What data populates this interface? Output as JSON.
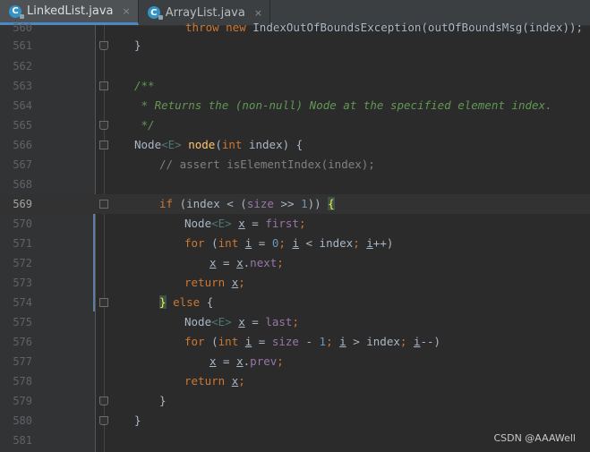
{
  "tabs": [
    {
      "label": "LinkedList.java",
      "icon": "class-c-icon",
      "close": "×"
    },
    {
      "label": "ArrayList.java",
      "icon": "class-c-icon",
      "close": "×"
    }
  ],
  "icon_letter": "C",
  "lines": [
    {
      "num": "560",
      "text": "throw new IndexOutOfBoundsException(outOfBoundsMsg(index));"
    },
    {
      "num": "561",
      "text": "}"
    },
    {
      "num": "562",
      "text": ""
    },
    {
      "num": "563",
      "text": "/**"
    },
    {
      "num": "564",
      "text": " * Returns the (non-null) Node at the specified element index."
    },
    {
      "num": "565",
      "text": " */"
    },
    {
      "num": "566",
      "text": "Node<E> node(int index) {"
    },
    {
      "num": "567",
      "text": "// assert isElementIndex(index);"
    },
    {
      "num": "568",
      "text": ""
    },
    {
      "num": "569",
      "text": "if (index < (size >> 1)) {"
    },
    {
      "num": "570",
      "text": "Node<E> x = first;"
    },
    {
      "num": "571",
      "text": "for (int i = 0; i < index; i++)"
    },
    {
      "num": "572",
      "text": "x = x.next;"
    },
    {
      "num": "573",
      "text": "return x;"
    },
    {
      "num": "574",
      "text": "} else {"
    },
    {
      "num": "575",
      "text": "Node<E> x = last;"
    },
    {
      "num": "576",
      "text": "for (int i = size - 1; i > index; i--)"
    },
    {
      "num": "577",
      "text": "x = x.prev;"
    },
    {
      "num": "578",
      "text": "return x;"
    },
    {
      "num": "579",
      "text": "}"
    },
    {
      "num": "580",
      "text": "}"
    },
    {
      "num": "581",
      "text": ""
    }
  ],
  "current_line": "569",
  "watermark": "CSDN @AAAWell",
  "colors": {
    "background": "#2b2b2b",
    "gutter": "#313335",
    "keyword": "#cc7832",
    "comment": "#808080",
    "doc_comment": "#629755",
    "method": "#ffc66d",
    "field": "#9876aa",
    "number": "#6897bb",
    "accent": "#4a88c7"
  }
}
